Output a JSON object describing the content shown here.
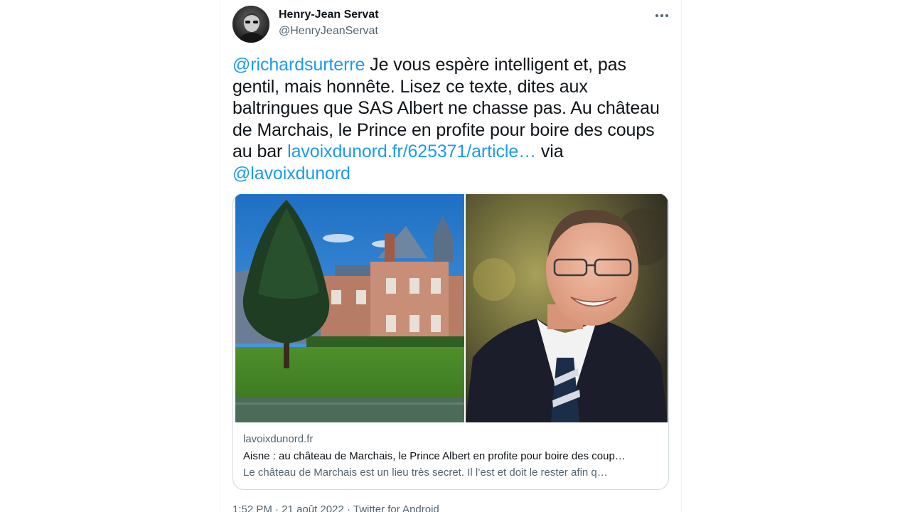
{
  "author": {
    "name": "Henry-Jean Servat",
    "handle": "@HenryJeanServat"
  },
  "more_icon": "more-horizontal-icon",
  "tweet": {
    "mention_richard": "@richardsurterre",
    "text_part1": " Je vous espère intelligent et, pas gentil, mais honnête. Lisez ce texte, dites aux baltringues que SAS Albert ne chasse pas. Au château de Marchais, le Prince en profite pour boire des coups au bar ",
    "link": "lavoixdunord.fr/625371/article…",
    "text_part2": " via ",
    "mention_lavoix": "@lavoixdunord"
  },
  "card": {
    "domain": "lavoixdunord.fr",
    "title": "Aisne : au château de Marchais, le Prince Albert en profite pour boire des coup…",
    "description": "Le château de Marchais est un lieu très secret. Il l’est et doit le rester afin q…"
  },
  "meta": {
    "time": "1:52 PM",
    "sep1": " · ",
    "date": "21 août 2022",
    "sep2": " · ",
    "source": "Twitter for Android"
  },
  "colors": {
    "link": "#1d9bf0",
    "text": "#0f1419",
    "secondary": "#536471",
    "border": "#cfd9de"
  }
}
